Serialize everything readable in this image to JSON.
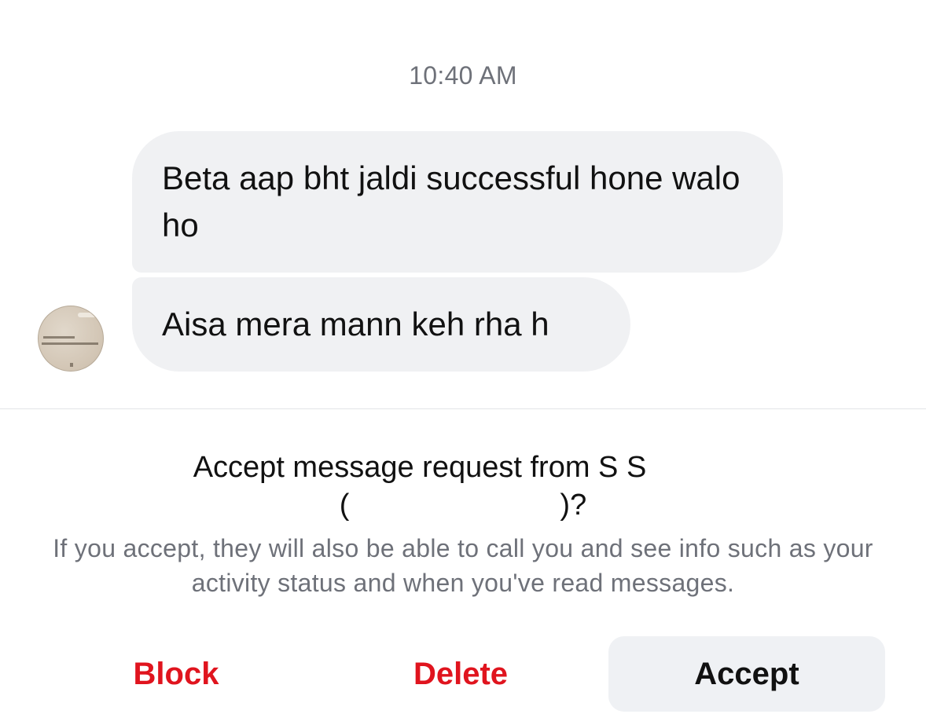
{
  "conversation": {
    "timestamp": "10:40 AM",
    "messages": [
      {
        "text": "Beta aap bht jaldi successful hone walo ho"
      },
      {
        "text": "Aisa mera mann keh rha h"
      }
    ]
  },
  "request": {
    "title_prefix": "Accept message request from S S",
    "title_suffix": "(",
    "title_end": ")?",
    "description": "If you accept, they will also be able to call you and see info such as your activity status and when you've read messages."
  },
  "actions": {
    "block_label": "Block",
    "delete_label": "Delete",
    "accept_label": "Accept"
  },
  "colors": {
    "destructive": "#e0141e",
    "bubble_bg": "#f0f1f3",
    "secondary_text": "#6e7179",
    "accept_bg": "#eff1f4"
  }
}
